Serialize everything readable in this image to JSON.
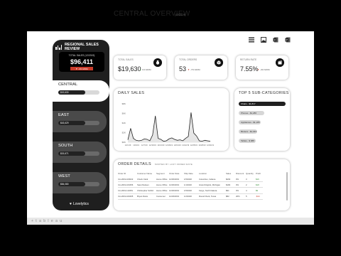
{
  "footer": {
    "brand": "+ t a b l e a u"
  },
  "sidebar": {
    "title": "REGIONAL SALES REVIEW",
    "card": {
      "label": "TOTAL SALES (12/2019)",
      "value": "$96,411",
      "change": "▼ -6% MOM"
    },
    "regions": [
      {
        "name": "CENTRAL",
        "value": "$19,630",
        "active": true
      },
      {
        "name": "EAST",
        "value": "$43,629",
        "active": false
      },
      {
        "name": "SOUTH",
        "value": "$15,671",
        "active": false
      },
      {
        "name": "WEST",
        "value": "$84,080",
        "active": false
      }
    ],
    "logo": "Lovelytics"
  },
  "header": {
    "title": "CENTRAL OVERVIEW",
    "time": "(12/2019)"
  },
  "toolbar": [
    "table-icon",
    "image-icon",
    "excel-icon",
    "powerpoint-icon"
  ],
  "kpis": [
    {
      "title": "TOTAL SALES",
      "value": "$19,630",
      "change": "1% MOM",
      "direction": "up",
      "icon": "money-bag-icon"
    },
    {
      "title": "TOTAL ORDERS",
      "value": "53",
      "change": "-7% MOM",
      "direction": "down",
      "icon": "box-icon"
    },
    {
      "title": "RETURN RATE",
      "value": "7.55%",
      "change": "-4% MOM",
      "direction": "down",
      "icon": "return-icon"
    }
  ],
  "daily_sales": {
    "title": "DAILY SALES"
  },
  "chart_data": {
    "type": "area",
    "title": "DAILY SALES",
    "x": [
      "12/1/19",
      "12/4/19",
      "12/7/19",
      "12/10/19",
      "12/13/19",
      "12/16/19",
      "12/19/19",
      "12/22/19",
      "12/25/19",
      "12/28/19",
      "12/31/19"
    ],
    "y_ticks": [
      "$8K",
      "$6K",
      "$4K",
      "$2K",
      "$0K"
    ],
    "ylim": [
      0,
      8000
    ],
    "values": [
      500,
      2900,
      800,
      400,
      300,
      400,
      700,
      600,
      300,
      1500,
      5500,
      800,
      600,
      200,
      300,
      700,
      900,
      600,
      400,
      500,
      300,
      800,
      1200,
      6200,
      1900,
      1300,
      300,
      200,
      400,
      300,
      200
    ],
    "color": "#222222",
    "grid": false
  },
  "top5": {
    "title": "TOP 5 SUB-CATEGORIES",
    "items": [
      {
        "label": "Chairs - $1,817",
        "fraction": 1.0
      },
      {
        "label": "Phones - $1,286",
        "fraction": 0.55
      },
      {
        "label": "Appliances - $1,185",
        "fraction": 0.47
      },
      {
        "label": "Binders - $1,043",
        "fraction": 0.4
      },
      {
        "label": "Tables - $ 988",
        "fraction": 0.36
      }
    ]
  },
  "orders": {
    "title": "ORDER DETAILS",
    "subtitle": "SORTED BY LAST ORDER DATE",
    "columns": [
      "Order ID",
      "Customer Name",
      "Segment",
      "Order Date",
      "Ship Date",
      "Location",
      "Sales",
      "Discount",
      "Quantity",
      "Profit"
    ],
    "rows": [
      [
        "CA-2019-163022",
        "Chuck Clark",
        "Home Office",
        "12/30/2019",
        "1/5/2020",
        "Columbus, Indiana",
        "$263",
        "0%",
        "3",
        "$16"
      ],
      [
        "CA-2019-163456",
        "Sara Paulsen",
        "Home Office",
        "12/30/2019",
        "1/1/2020",
        "Grand Rapids, Michigan",
        "$184",
        "0%",
        "2",
        "$18"
      ],
      [
        "CA-2019-113451",
        "Christopher Schild",
        "Home Office",
        "12/30/2019",
        "1/5/2020",
        "Fargo, North Dakota",
        "$91",
        "0%",
        "4",
        "$9"
      ],
      [
        "CA-2019-100405",
        "Bryan Davis",
        "Consumer",
        "12/29/2019",
        "1/2/2020",
        "Round Rock, Texas",
        "$82",
        "20%",
        "5",
        "-$14"
      ]
    ]
  },
  "colors": {
    "dark": "#1f1f1f",
    "down": "#c83c2b",
    "up": "#3a8f3a"
  }
}
